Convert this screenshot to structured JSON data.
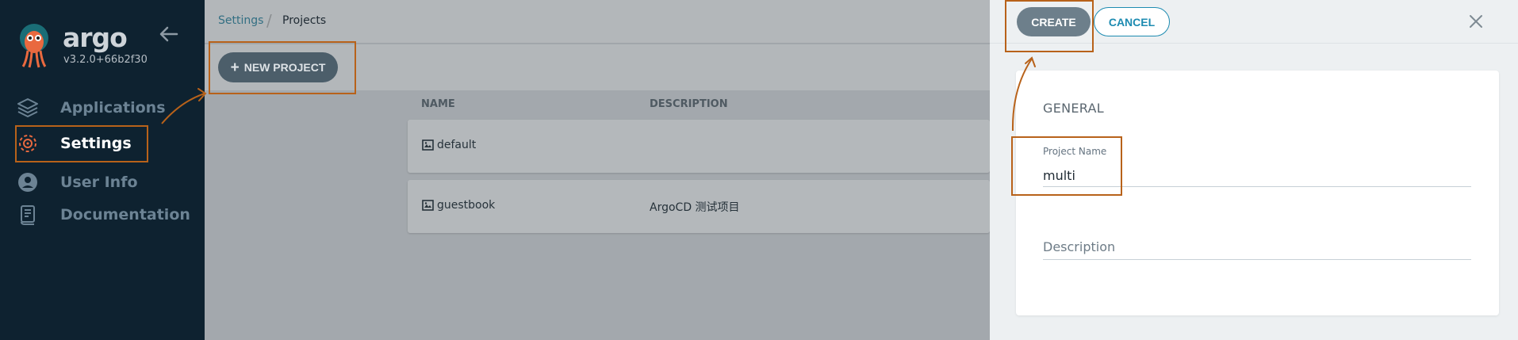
{
  "app": {
    "brand": "argo",
    "version": "v3.2.0+66b2f30"
  },
  "sidebar": {
    "items": [
      {
        "label": "Applications",
        "icon": "layers-icon"
      },
      {
        "label": "Settings",
        "icon": "gear-icon",
        "active": true
      },
      {
        "label": "User Info",
        "icon": "user-icon"
      },
      {
        "label": "Documentation",
        "icon": "book-icon"
      }
    ]
  },
  "breadcrumb": {
    "parent": "Settings",
    "separator": "/",
    "current": "Projects"
  },
  "toolbar": {
    "new_project_label": "NEW PROJECT"
  },
  "table": {
    "columns": [
      "NAME",
      "DESCRIPTION"
    ],
    "rows": [
      {
        "name": "default",
        "description": ""
      },
      {
        "name": "guestbook",
        "description": "ArgoCD 测试项目"
      }
    ]
  },
  "panel": {
    "create_label": "CREATE",
    "cancel_label": "CANCEL",
    "section_title": "GENERAL",
    "project_name_label": "Project Name",
    "project_name_value": "multi",
    "description_placeholder": "Description"
  },
  "colors": {
    "sidebar_bg": "#0e2230",
    "accent": "#1d8bb1",
    "annotation": "#b8621a"
  }
}
